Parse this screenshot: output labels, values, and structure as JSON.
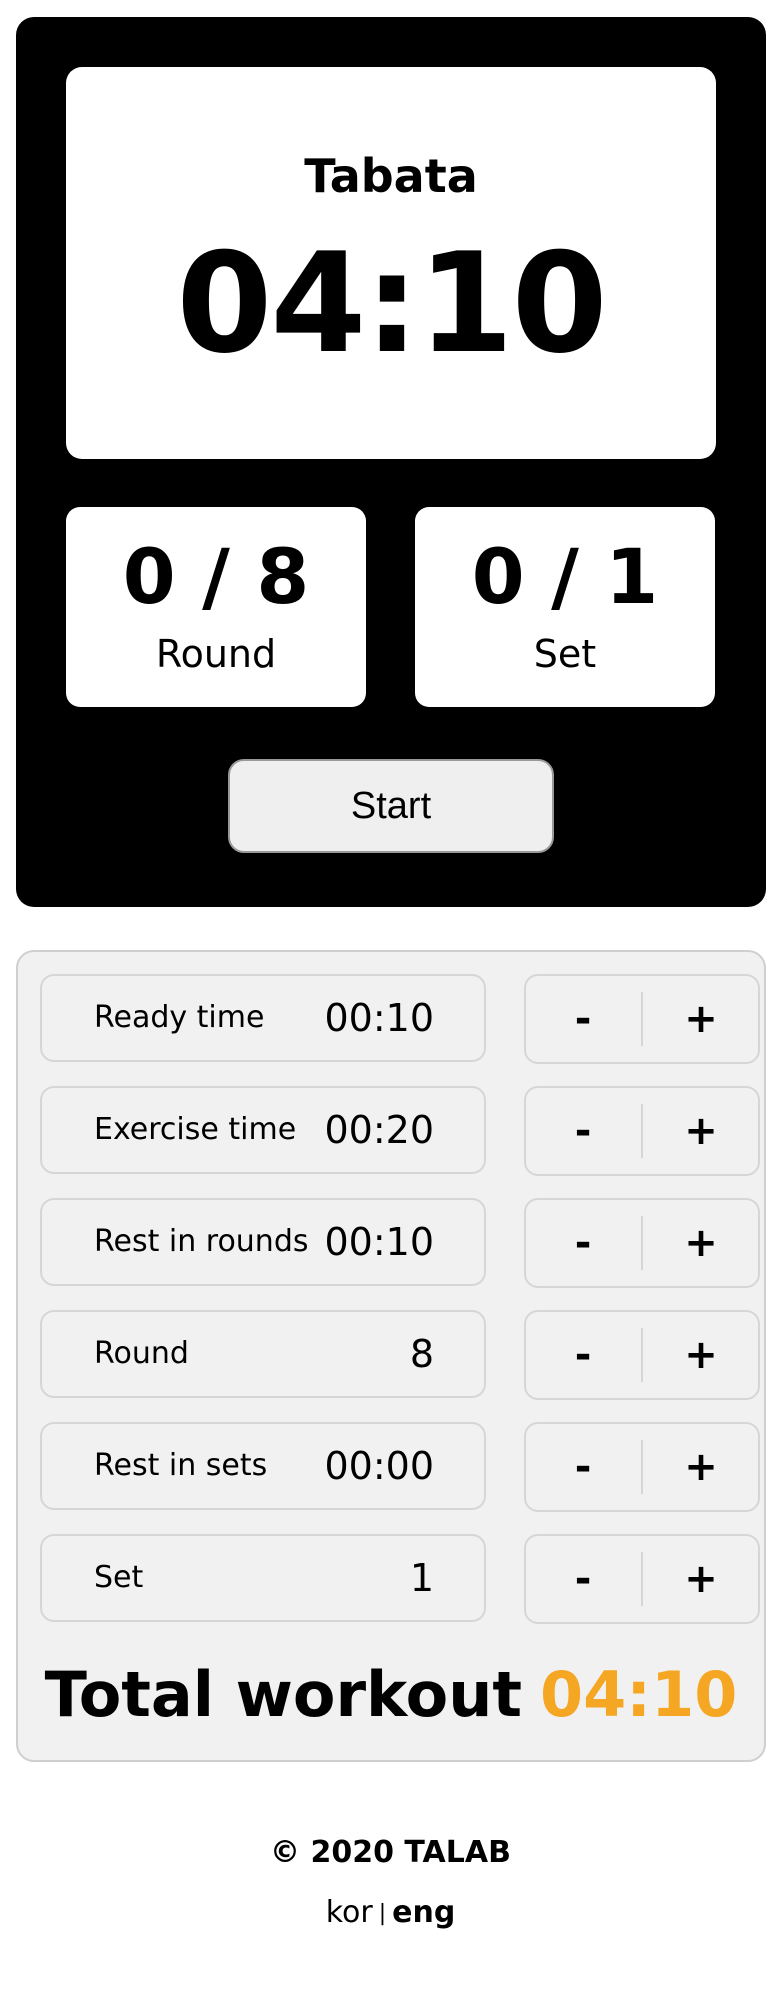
{
  "timer": {
    "mode_title": "Tabata",
    "time": "04:10",
    "round": {
      "value": "0 / 8",
      "label": "Round"
    },
    "set": {
      "value": "0 / 1",
      "label": "Set"
    },
    "start_label": "Start"
  },
  "settings": {
    "rows": [
      {
        "label": "Ready time",
        "value": "00:10",
        "minus": "-",
        "plus": "+"
      },
      {
        "label": "Exercise time",
        "value": "00:20",
        "minus": "-",
        "plus": "+"
      },
      {
        "label": "Rest in rounds",
        "value": "00:10",
        "minus": "-",
        "plus": "+"
      },
      {
        "label": "Round",
        "value": "8",
        "minus": "-",
        "plus": "+"
      },
      {
        "label": "Rest in sets",
        "value": "00:00",
        "minus": "-",
        "plus": "+"
      },
      {
        "label": "Set",
        "value": "1",
        "minus": "-",
        "plus": "+"
      }
    ],
    "total_label": "Total workout",
    "total_value": "04:10"
  },
  "footer": {
    "copyright": "© 2020 TALAB",
    "lang_kor": "kor",
    "lang_separator": "|",
    "lang_eng": "eng",
    "active_lang": "eng"
  },
  "colors": {
    "accent": "#f5a623",
    "panel_dark": "#000000",
    "panel_light": "#f1f1f1"
  }
}
